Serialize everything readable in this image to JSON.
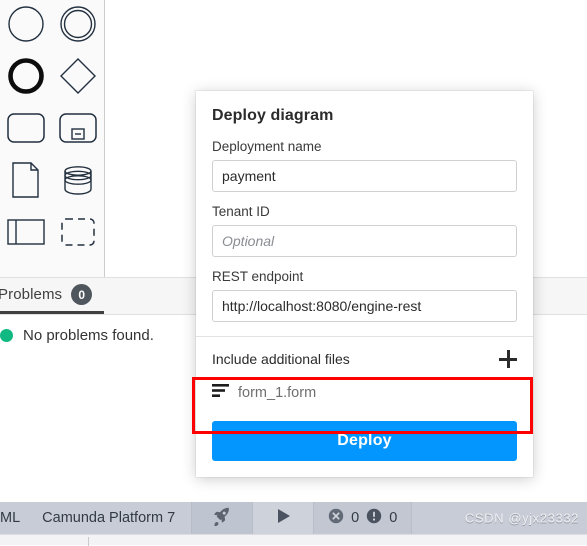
{
  "palette": {
    "name": "bpmn-element-palette",
    "items": [
      {
        "icon": "start-event-circle-icon",
        "label": "Start event"
      },
      {
        "icon": "intermediate-event-double-circle-icon",
        "label": "Intermediate event"
      },
      {
        "icon": "end-event-thick-circle-icon",
        "label": "End event"
      },
      {
        "icon": "gateway-diamond-icon",
        "label": "Gateway"
      },
      {
        "icon": "task-rounded-rect-icon",
        "label": "Task"
      },
      {
        "icon": "subprocess-collapsed-icon",
        "label": "Sub-process"
      },
      {
        "icon": "data-object-icon",
        "label": "Data object"
      },
      {
        "icon": "data-store-cylinder-icon",
        "label": "Data store"
      },
      {
        "icon": "participant-pool-icon",
        "label": "Participant / Pool"
      },
      {
        "icon": "group-dashed-rect-icon",
        "label": "Group"
      }
    ]
  },
  "problems": {
    "tab_label": "Problems",
    "tab_badge": "0",
    "empty_message": "No problems found.",
    "status_color": "#10b981"
  },
  "deploy_dialog": {
    "title": "Deploy diagram",
    "fields": [
      {
        "name": "deployment-name",
        "label": "Deployment name",
        "value": "payment",
        "placeholder": ""
      },
      {
        "name": "tenant-id",
        "label": "Tenant ID",
        "value": "",
        "placeholder": "Optional"
      },
      {
        "name": "rest-endpoint",
        "label": "REST endpoint",
        "value": "http://localhost:8080/engine-rest",
        "placeholder": ""
      }
    ],
    "additional_files": {
      "title": "Include additional files",
      "add_icon": "plus-icon",
      "files": [
        {
          "icon": "form-file-icon",
          "name": "form_1.form"
        }
      ]
    },
    "submit_label": "Deploy",
    "accent_color": "#0496ff"
  },
  "annotation": {
    "name": "red-highlight-box",
    "color": "#ff0000"
  },
  "status_bar": {
    "xml_label": "ML",
    "platform_label": "Camunda Platform 7",
    "deploy_icon": "rocket-icon",
    "run_icon": "play-icon",
    "error_icon": "error-circle-icon",
    "error_count": "0",
    "warning_icon": "warning-circle-icon",
    "warning_count": "0",
    "watermark": "CSDN @yjx23332"
  }
}
